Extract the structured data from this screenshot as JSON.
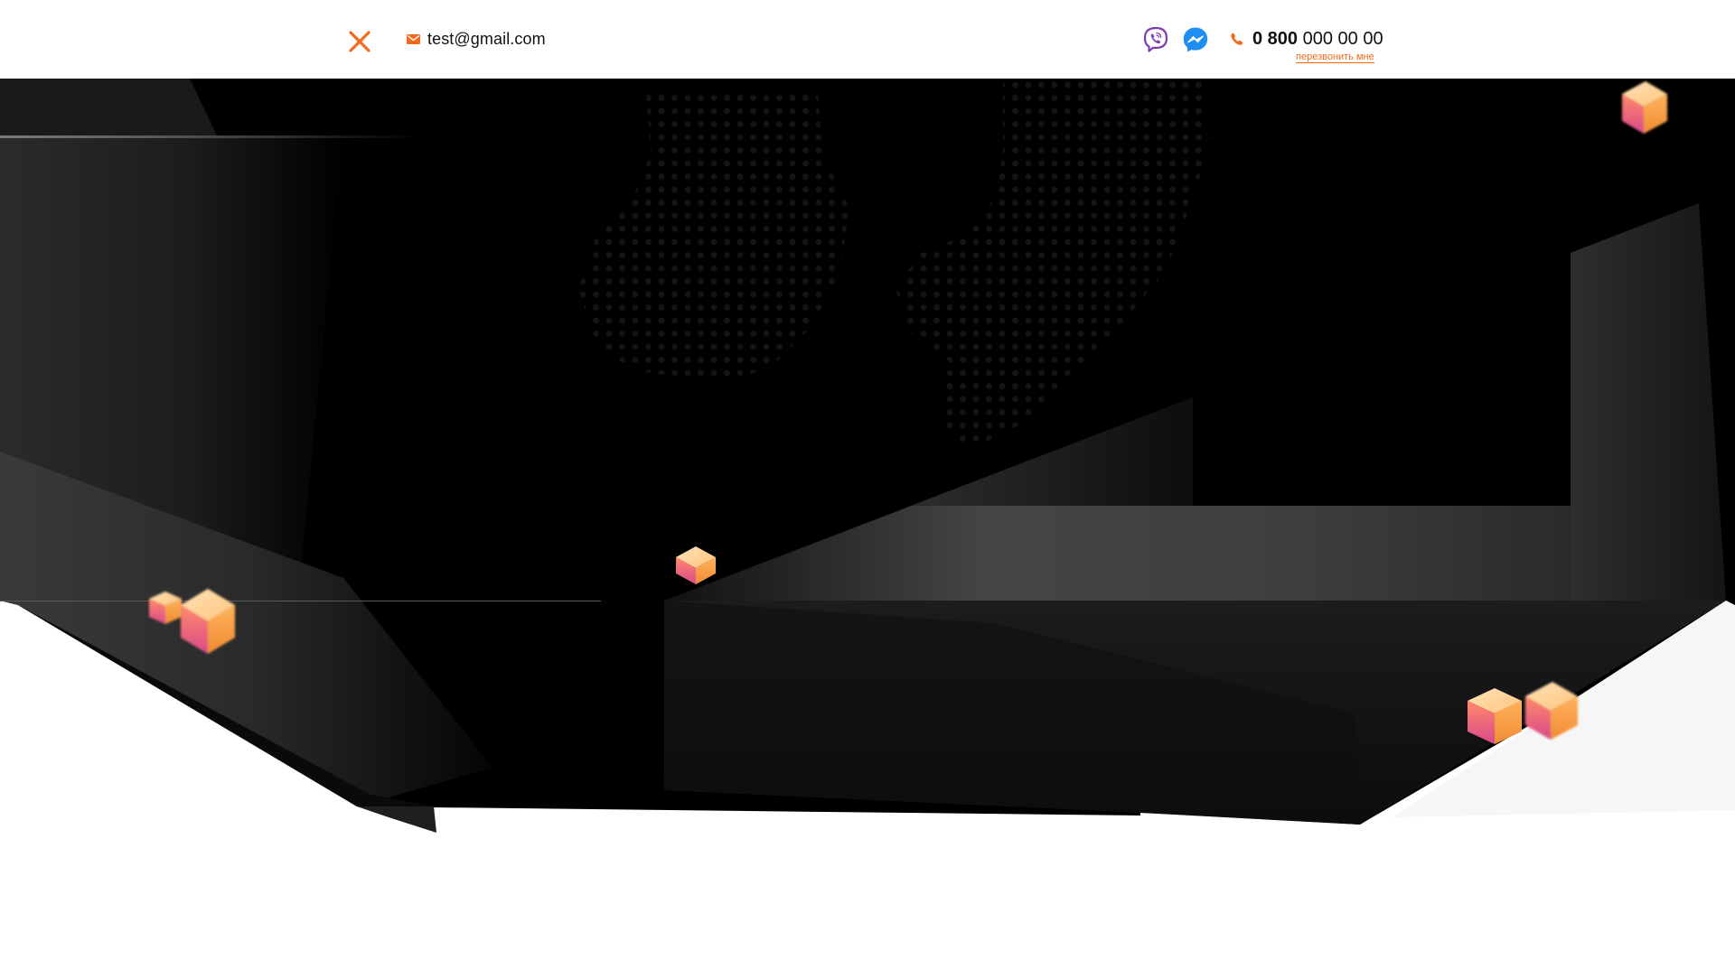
{
  "header": {
    "email": "test@gmail.com",
    "phone_prefix": "0 800",
    "phone_rest": "000 00 00",
    "callback_label": "перезвонить мне"
  },
  "icons": {
    "close": "close-icon",
    "email": "envelope-icon",
    "viber": "viber-icon",
    "messenger": "messenger-icon",
    "phone": "phone-icon"
  },
  "colors": {
    "accent": "#f26a1b",
    "viber": "#7d3daf",
    "messenger": "#1f8ef1",
    "hero_bg": "#000000"
  }
}
